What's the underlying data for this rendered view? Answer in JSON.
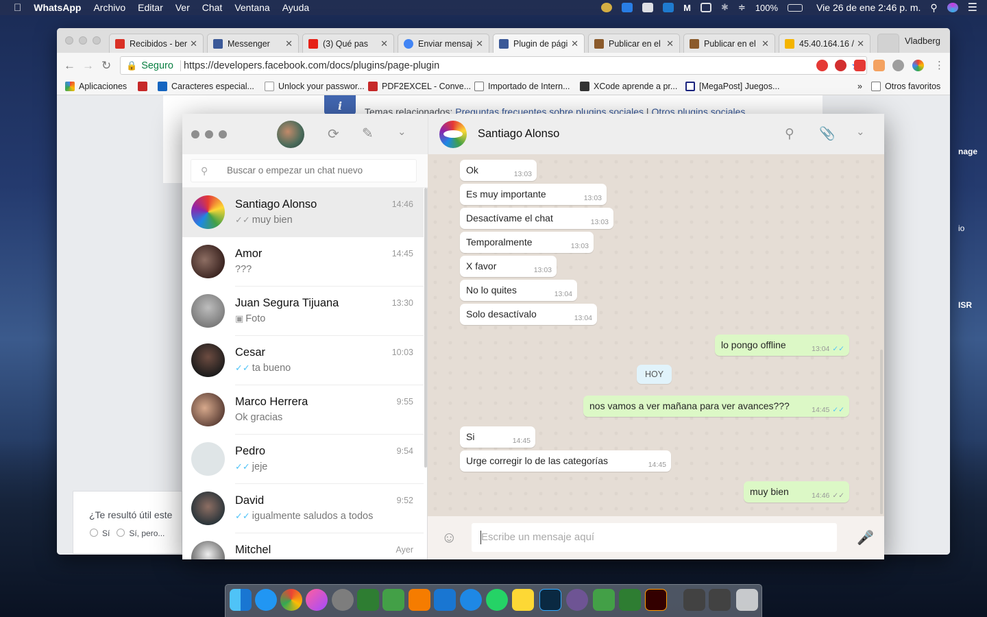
{
  "menubar": {
    "apple": "",
    "app": "WhatsApp",
    "items": [
      "Archivo",
      "Editar",
      "Ver",
      "Chat",
      "Ventana",
      "Ayuda"
    ],
    "battery": "100%",
    "datetime": "Vie 26 de ene  2:46 p. m."
  },
  "browser": {
    "tabs": [
      {
        "label": "Recibidos - ber",
        "color": "#d93025"
      },
      {
        "label": "Messenger",
        "color": "#3b5998"
      },
      {
        "label": "(3) Qué pas",
        "color": "#e62117"
      },
      {
        "label": "Enviar mensaje",
        "color": "#4285f4"
      },
      {
        "label": "Plugin de págin",
        "color": "#3b5998"
      },
      {
        "label": "Publicar en el n",
        "color": "#8b5a2b"
      },
      {
        "label": "Publicar en el n",
        "color": "#8b5a2b"
      },
      {
        "label": "45.40.164.16 / ",
        "color": "#f4b400"
      }
    ],
    "profile": "Vladberg",
    "secure_label": "Seguro",
    "url": "https://developers.facebook.com/docs/plugins/page-plugin",
    "bookmarks": [
      "Aplicaciones",
      "",
      "Caracteres especial...",
      "Unlock your passwor...",
      "PDF2EXCEL - Conve...",
      "Importado de Intern...",
      "XCode aprende a pr...",
      "[MegaPost] Juegos..."
    ],
    "bookmarks_more": "»",
    "other_bookmarks": "Otros favoritos"
  },
  "fbpage": {
    "related_prefix": "Temas relacionados: ",
    "related_link1": "Preguntas frecuentes sobre plugins sociales",
    "related_sep": " | ",
    "related_link2": "Otros plugins sociales",
    "helpful_q": "¿Te resultó útil este",
    "helpful_opt1": "Sí",
    "helpful_opt2": "Sí, pero...",
    "peek1": "nage",
    "peek2": "io",
    "peek3": "ISR"
  },
  "whatsapp": {
    "search_placeholder": "Buscar o empezar un chat nuevo",
    "contact": "Santiago Alonso",
    "composer_placeholder": "Escribe un mensaje aquí",
    "day_separator": "HOY",
    "chats": [
      {
        "name": "Santiago Alonso",
        "time": "14:46",
        "last": "muy bien",
        "tick": "grey"
      },
      {
        "name": "Amor",
        "time": "14:45",
        "last": "???",
        "tick": ""
      },
      {
        "name": "Juan Segura Tijuana",
        "time": "13:30",
        "last": "Foto",
        "tick": "camera"
      },
      {
        "name": "Cesar",
        "time": "10:03",
        "last": "ta bueno",
        "tick": "blue"
      },
      {
        "name": "Marco Herrera",
        "time": "9:55",
        "last": "Ok gracias",
        "tick": ""
      },
      {
        "name": "Pedro",
        "time": "9:54",
        "last": "jeje",
        "tick": "blue"
      },
      {
        "name": "David",
        "time": "9:52",
        "last": "igualmente saludos a todos",
        "tick": "blue"
      },
      {
        "name": "Mitchel",
        "time": "Ayer",
        "last": "",
        "tick": ""
      }
    ],
    "messages": [
      {
        "text": "Ok",
        "time": "13:03",
        "dir": "in"
      },
      {
        "text": "Es muy importante",
        "time": "13:03",
        "dir": "in"
      },
      {
        "text": "Desactívame el chat",
        "time": "13:03",
        "dir": "in"
      },
      {
        "text": "Temporalmente",
        "time": "13:03",
        "dir": "in"
      },
      {
        "text": "X favor",
        "time": "13:03",
        "dir": "in"
      },
      {
        "text": "No lo quites",
        "time": "13:04",
        "dir": "in"
      },
      {
        "text": "Solo desactívalo",
        "time": "13:04",
        "dir": "in"
      },
      {
        "text": "lo pongo offline",
        "time": "13:04",
        "dir": "out"
      },
      {
        "text": "nos vamos a ver mañana para ver avances???",
        "time": "14:45",
        "dir": "out"
      },
      {
        "text": "Si",
        "time": "14:45",
        "dir": "in"
      },
      {
        "text": "Urge corregir lo de las categorías",
        "time": "14:45",
        "dir": "in"
      },
      {
        "text": "muy bien",
        "time": "14:46",
        "dir": "out"
      }
    ]
  }
}
